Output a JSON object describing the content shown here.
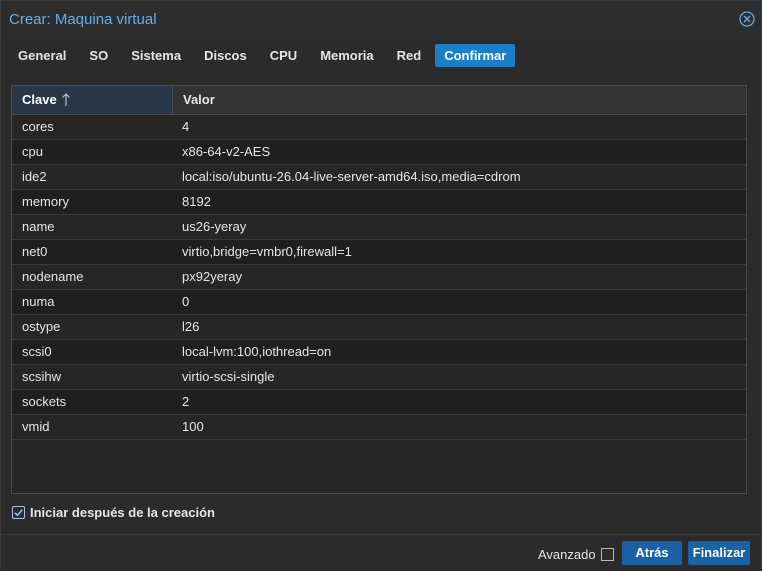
{
  "window": {
    "title": "Crear: Maquina virtual",
    "accent": "#5fb0f0"
  },
  "tabs": [
    {
      "label": "General",
      "active": false
    },
    {
      "label": "SO",
      "active": false
    },
    {
      "label": "Sistema",
      "active": false
    },
    {
      "label": "Discos",
      "active": false
    },
    {
      "label": "CPU",
      "active": false
    },
    {
      "label": "Memoria",
      "active": false
    },
    {
      "label": "Red",
      "active": false
    },
    {
      "label": "Confirmar",
      "active": true
    }
  ],
  "grid": {
    "columns": {
      "key": "Clave",
      "value": "Valor"
    },
    "sort": {
      "column": "key",
      "direction": "ascending",
      "icon": "arrow-up-icon"
    },
    "rows": [
      {
        "key": "cores",
        "value": "4"
      },
      {
        "key": "cpu",
        "value": "x86-64-v2-AES"
      },
      {
        "key": "ide2",
        "value": "local:iso/ubuntu-26.04-live-server-amd64.iso,media=cdrom"
      },
      {
        "key": "memory",
        "value": "8192"
      },
      {
        "key": "name",
        "value": "us26-yeray"
      },
      {
        "key": "net0",
        "value": "virtio,bridge=vmbr0,firewall=1"
      },
      {
        "key": "nodename",
        "value": "px92yeray"
      },
      {
        "key": "numa",
        "value": "0"
      },
      {
        "key": "ostype",
        "value": "l26"
      },
      {
        "key": "scsi0",
        "value": "local-lvm:100,iothread=on"
      },
      {
        "key": "scsihw",
        "value": "virtio-scsi-single"
      },
      {
        "key": "sockets",
        "value": "2"
      },
      {
        "key": "vmid",
        "value": "100"
      }
    ]
  },
  "options": {
    "start_after_create": {
      "label": "Iniciar después de la creación",
      "checked": true
    }
  },
  "footer": {
    "advanced_label": "Avanzado",
    "advanced_checked": false,
    "back_label": "Atrás",
    "finish_label": "Finalizar"
  }
}
